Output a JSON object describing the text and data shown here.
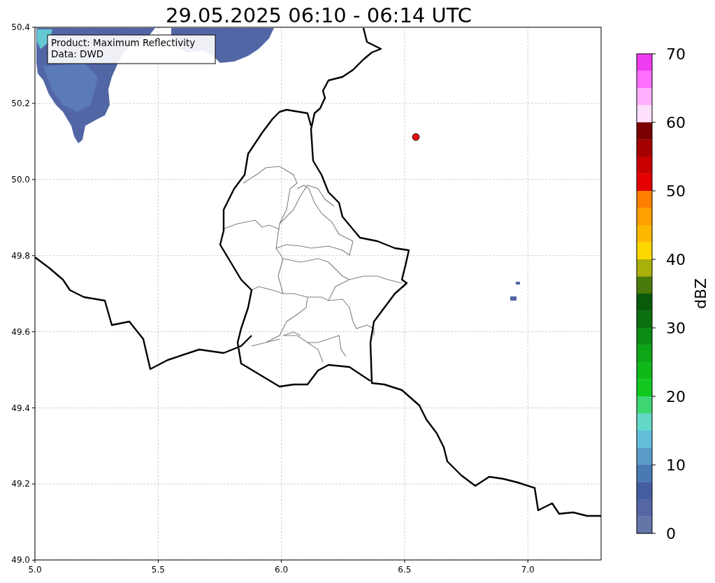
{
  "title": "29.05.2025 06:10 - 06:14 UTC",
  "map": {
    "info_box": [
      "Product: Maximum Reflectivity",
      "Data: DWD"
    ],
    "x_ticks": [
      "5.0",
      "5.5",
      "6.0",
      "6.5",
      "7.0"
    ],
    "y_ticks": [
      "50.4",
      "50.2",
      "50.0",
      "49.8",
      "49.6",
      "49.4",
      "49.2",
      "49.0"
    ]
  },
  "colorbar": {
    "label": "dBZ",
    "ticks": [
      "70",
      "60",
      "50",
      "40",
      "30",
      "20",
      "10",
      "0"
    ],
    "bins": [
      {
        "color": "#f03cf0"
      },
      {
        "color": "#ff70ff"
      },
      {
        "color": "#ffb0ff"
      },
      {
        "color": "#ffe0ff"
      },
      {
        "color": "#7a0000"
      },
      {
        "color": "#a50000"
      },
      {
        "color": "#c80000"
      },
      {
        "color": "#e50000"
      },
      {
        "color": "#ff7f00"
      },
      {
        "color": "#ff9f00"
      },
      {
        "color": "#ffb800"
      },
      {
        "color": "#ffd700"
      },
      {
        "color": "#aab00a"
      },
      {
        "color": "#4a7a0a"
      },
      {
        "color": "#0a5a0c"
      },
      {
        "color": "#0a7010"
      },
      {
        "color": "#0b8c12"
      },
      {
        "color": "#0ea516"
      },
      {
        "color": "#10b81a"
      },
      {
        "color": "#12c820"
      },
      {
        "color": "#3dd673"
      },
      {
        "color": "#64d8c8"
      },
      {
        "color": "#62bedb"
      },
      {
        "color": "#5a9cc8"
      },
      {
        "color": "#4a7ab3"
      },
      {
        "color": "#435da0"
      },
      {
        "color": "#5566a5"
      },
      {
        "color": "#6475a8"
      }
    ]
  }
}
